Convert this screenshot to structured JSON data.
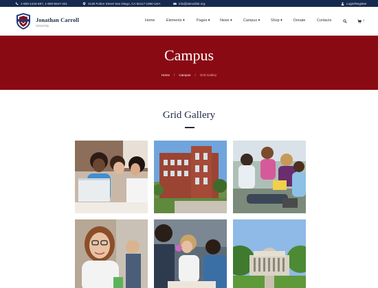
{
  "topbar": {
    "phone": "1-800-1234-567, 1-800-6547-321",
    "address": "2130 Fulton Street San Diego, CA 94117-1080 USA",
    "email": "info@demolink.org",
    "login": "Login/Register"
  },
  "brand": {
    "name": "Jonathan Carroll",
    "subtitle": "University"
  },
  "nav": {
    "items": [
      {
        "label": "Home"
      },
      {
        "label": "Elements"
      },
      {
        "label": "Pages"
      },
      {
        "label": "News"
      },
      {
        "label": "Campus"
      },
      {
        "label": "Shop"
      },
      {
        "label": "Donate"
      },
      {
        "label": "Contacts"
      }
    ],
    "cart_count": "2"
  },
  "banner": {
    "title": "Campus",
    "breadcrumb": [
      "Home",
      "Campus",
      "Grid Gallery"
    ],
    "separator": "/",
    "color": "#8a0a14"
  },
  "section": {
    "title": "Grid Gallery"
  },
  "colors": {
    "topbar": "#162a4f",
    "accent": "#8a0a14",
    "heading": "#1e2a44"
  },
  "icons": [
    "phone-icon",
    "location-icon",
    "mail-icon",
    "user-icon",
    "search-icon",
    "cart-icon",
    "shield-logo-icon"
  ],
  "gallery": [
    {
      "subject": "students-laptop-photo"
    },
    {
      "subject": "brick-building-photo"
    },
    {
      "subject": "students-outdoors-photo"
    },
    {
      "subject": "girl-glasses-photo"
    },
    {
      "subject": "students-studying-photo"
    },
    {
      "subject": "domed-building-photo"
    }
  ]
}
